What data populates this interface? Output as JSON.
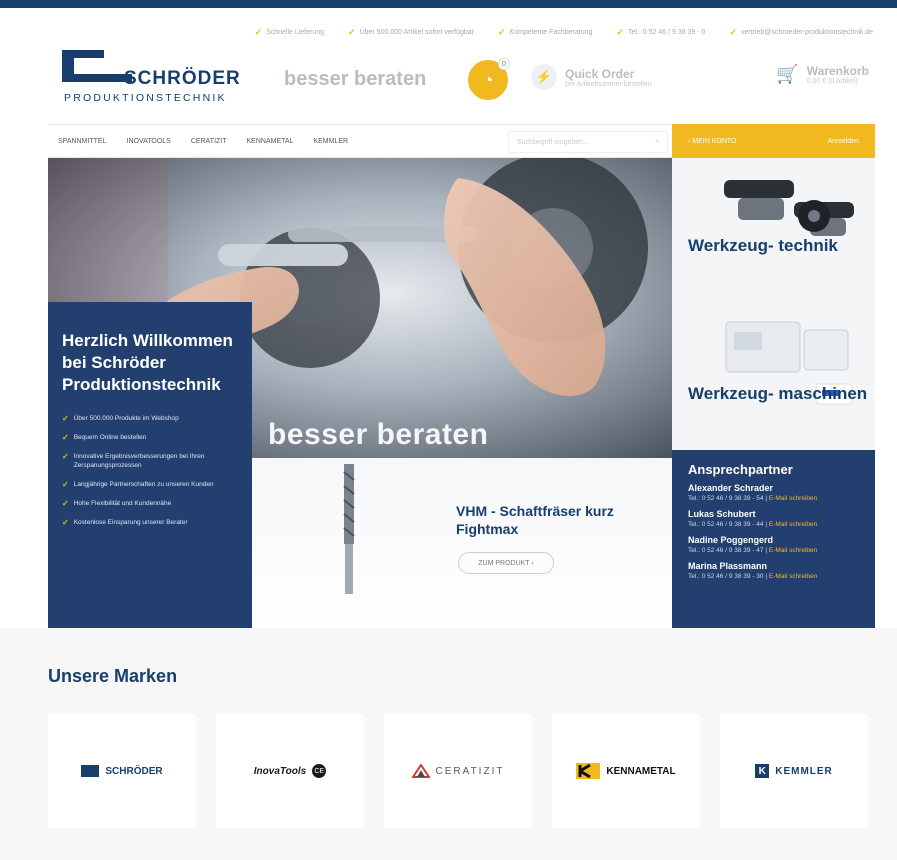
{
  "brand": {
    "name": "SCHRÖDER",
    "sub": "PRODUKTIONSTECHNIK",
    "slogan": "besser beraten"
  },
  "usps": [
    "Schnelle Lieferung",
    "Über 500.000 Artikel sofort verfügbar",
    "Kompetente Fachberatung",
    "Tel.: 0 52 46 / 9 38 39 - 0",
    "vertrieb@schroeder-produktionstechnik.de"
  ],
  "header": {
    "quick_order_title": "Quick Order",
    "quick_order_sub": "per Artikelnummer bestellen",
    "cart_title": "Warenkorb",
    "cart_sub": "0,00 € (0 Artikel)",
    "badge_count": "0"
  },
  "nav": {
    "items": [
      "SPANNMITTEL",
      "INOVATOOLS",
      "CERATIZIT",
      "KENNAMETAL",
      "KEMMLER"
    ],
    "search_placeholder": "Suchbegriff eingeben..."
  },
  "account": {
    "label": "MEIN KONTO",
    "action": "Anmelden"
  },
  "hero": {
    "welcome_title": "Herzlich Willkommen bei Schröder Produktionstechnik",
    "bullets": [
      "Über 500.000 Produkte im Webshop",
      "Bequem Online bestellen",
      "Innovative Ergebnisverbesserungen bei Ihren Zerspanungsprozessen",
      "Langjährige Partnerschaften zu unseren Kunden",
      "Hohe Flexibilität und Kundennähe",
      "Kostenlose Einsparung unserer Berater"
    ],
    "slogan": "besser beraten",
    "product_title": "VHM - Schaftfräser kurz Fightmax",
    "product_button": "ZUM PRODUKT  ›"
  },
  "side": {
    "tile1": "Werkzeug-\ntechnik",
    "tile2": "Werkzeug-\nmaschinen",
    "contacts_title": "Ansprechpartner",
    "contacts": [
      {
        "name": "Alexander Schrader",
        "line": "Tel.: 0 52 46 / 9 38 39 - 54",
        "link": "E-Mail schreiben"
      },
      {
        "name": "Lukas Schubert",
        "line": "Tel.: 0 52 46 / 9 38 39 - 44",
        "link": "E-Mail schreiben"
      },
      {
        "name": "Nadine Poggengerd",
        "line": "Tel.: 0 52 46 / 9 38 39 - 47",
        "link": "E-Mail schreiben"
      },
      {
        "name": "Marina Plassmann",
        "line": "Tel.: 0 52 46 / 9 38 39 - 30",
        "link": "E-Mail schreiben"
      }
    ]
  },
  "brands": {
    "title": "Unsere Marken",
    "items": [
      "SCHRÖDER",
      "InovaTools",
      "CERATIZIT",
      "KENNAMETAL",
      "KEMMLER"
    ]
  },
  "colors": {
    "navy": "#173e6d",
    "accent": "#f0b91f",
    "panel": "#233f70"
  }
}
